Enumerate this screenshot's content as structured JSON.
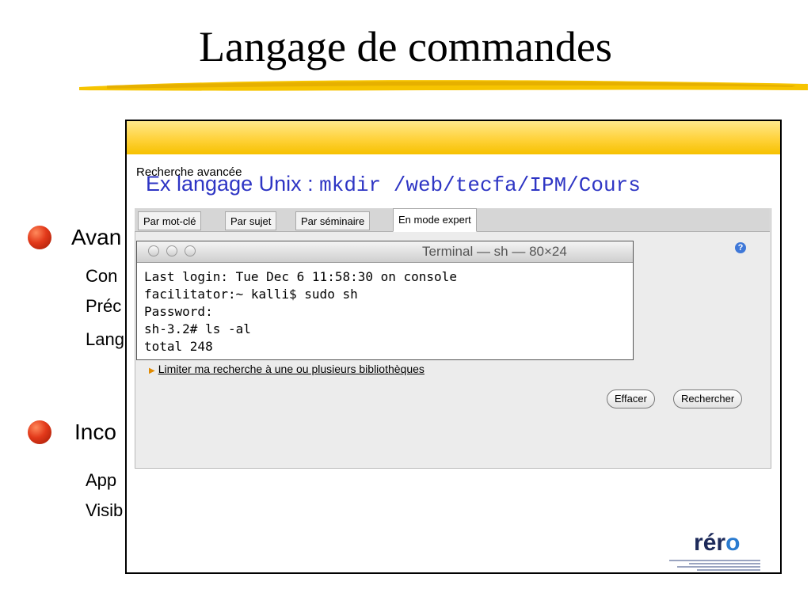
{
  "slide": {
    "title": "Langage de commandes",
    "bullets": [
      {
        "text": "Avan",
        "subs": [
          "Con",
          "Préc",
          "Lang"
        ]
      },
      {
        "text": "Inco",
        "subs": [
          "App",
          "Visib"
        ]
      }
    ]
  },
  "window": {
    "section_label": "Recherche avancée",
    "overlay_prefix": "Ex langage Unix : ",
    "overlay_command": "mkdir /web/tecfa/IPM/Cours",
    "tabs": [
      {
        "label": "Par mot-clé",
        "active": false
      },
      {
        "label": "Par sujet",
        "active": false
      },
      {
        "label": "Par séminaire",
        "active": false
      },
      {
        "label": "En mode expert",
        "active": true
      }
    ],
    "help_icon": "question-icon",
    "terminal": {
      "title": "Terminal — sh — 80×24",
      "lines": [
        "Last login: Tue Dec  6 11:58:30 on console",
        "facilitator:~ kalli$ sudo sh",
        "Password:",
        "sh-3.2# ls -al",
        "total 248"
      ]
    },
    "limit_link": "Limiter ma recherche à une ou plusieurs bibliothèques",
    "buttons": {
      "clear": "Effacer",
      "search": "Rechercher"
    },
    "logo": {
      "text_r": "r",
      "text_e": "é",
      "text_r2": "r",
      "text_o": "o"
    }
  },
  "colors": {
    "accent": "#ffd23a",
    "overlay_text": "#2e35c4",
    "bullet": "#e2391a"
  }
}
